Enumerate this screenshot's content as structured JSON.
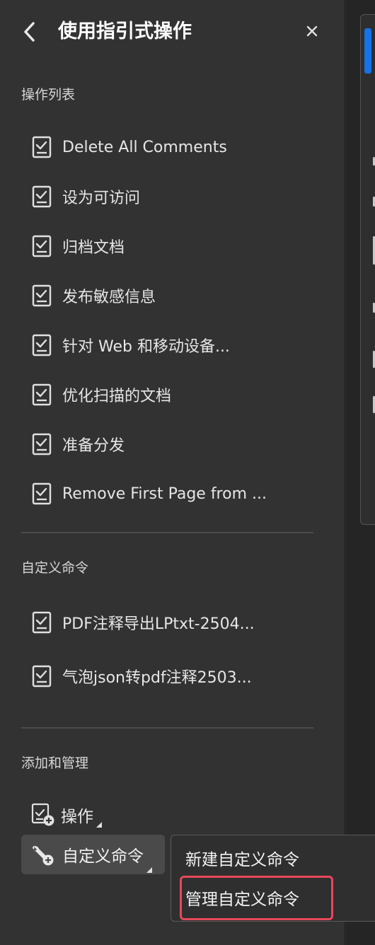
{
  "header": {
    "title": "使用指引式操作",
    "back_icon": "chevron-left-icon",
    "close_icon": "close-icon"
  },
  "actions_section": {
    "heading": "操作列表",
    "items": [
      {
        "label": "Delete All Comments",
        "icon": "checklist-icon"
      },
      {
        "label": "设为可访问",
        "icon": "checklist-icon"
      },
      {
        "label": "归档文档",
        "icon": "checklist-icon"
      },
      {
        "label": "发布敏感信息",
        "icon": "checklist-icon"
      },
      {
        "label": "针对 Web 和移动设备...",
        "icon": "checklist-icon"
      },
      {
        "label": "优化扫描的文档",
        "icon": "checklist-icon"
      },
      {
        "label": "准备分发",
        "icon": "checklist-icon"
      },
      {
        "label": "Remove First Page from ...",
        "icon": "checklist-icon"
      }
    ]
  },
  "custom_section": {
    "heading": "自定义命令",
    "items": [
      {
        "label": "PDF注释导出LPtxt-2504...",
        "icon": "checklist-icon"
      },
      {
        "label": "气泡json转pdf注释2503...",
        "icon": "checklist-icon"
      }
    ]
  },
  "manage_section": {
    "heading": "添加和管理",
    "actions_label": "操作",
    "custom_commands_label": "自定义命令"
  },
  "popup_menu": {
    "items": [
      {
        "label": "新建自定义命令"
      },
      {
        "label": "管理自定义命令"
      }
    ]
  },
  "colors": {
    "panel_bg": "#323232",
    "highlight": "#e8485b",
    "accent_blue": "#1473e6"
  }
}
